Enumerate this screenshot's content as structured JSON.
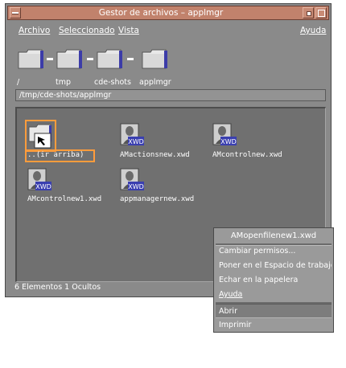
{
  "window": {
    "title": "Gestor de archivos – applmgr"
  },
  "menubar": {
    "file": "Archivo",
    "selected": "Seleccionado",
    "view": "Vista",
    "help": "Ayuda"
  },
  "path": {
    "segments": [
      "/",
      "tmp",
      "cde-shots",
      "applmgr"
    ],
    "field_value": "/tmp/cde-shots/applmgr"
  },
  "files": [
    {
      "label": "..(ir arriba)",
      "icon": "folder-up-icon"
    },
    {
      "label": "AMactionsnew.xwd",
      "icon": "xwd-image-icon",
      "badge": "XWD"
    },
    {
      "label": "AMcontrolnew.xwd",
      "icon": "xwd-image-icon",
      "badge": "XWD"
    },
    {
      "label": "AMcontrolnew1.xwd",
      "icon": "xwd-image-icon",
      "badge": "XWD"
    },
    {
      "label": "appmanagernew.xwd",
      "icon": "xwd-image-icon",
      "badge": "XWD"
    }
  ],
  "status": {
    "text": "6 Elementos 1 Ocultos"
  },
  "popup": {
    "title": "AMopenfilenew1.xwd",
    "items": [
      "Cambiar permisos...",
      "Poner en el Espacio de trabajo",
      "Echar en la papelera",
      "Ayuda",
      "Abrir",
      "Imprimir"
    ]
  },
  "colors": {
    "titlebar": "#c1826c",
    "window_bg": "#8a8a8a",
    "viewport_bg": "#707070",
    "selection_frame": "#ff9c3c",
    "xwd_badge": "#3a3fb0"
  }
}
